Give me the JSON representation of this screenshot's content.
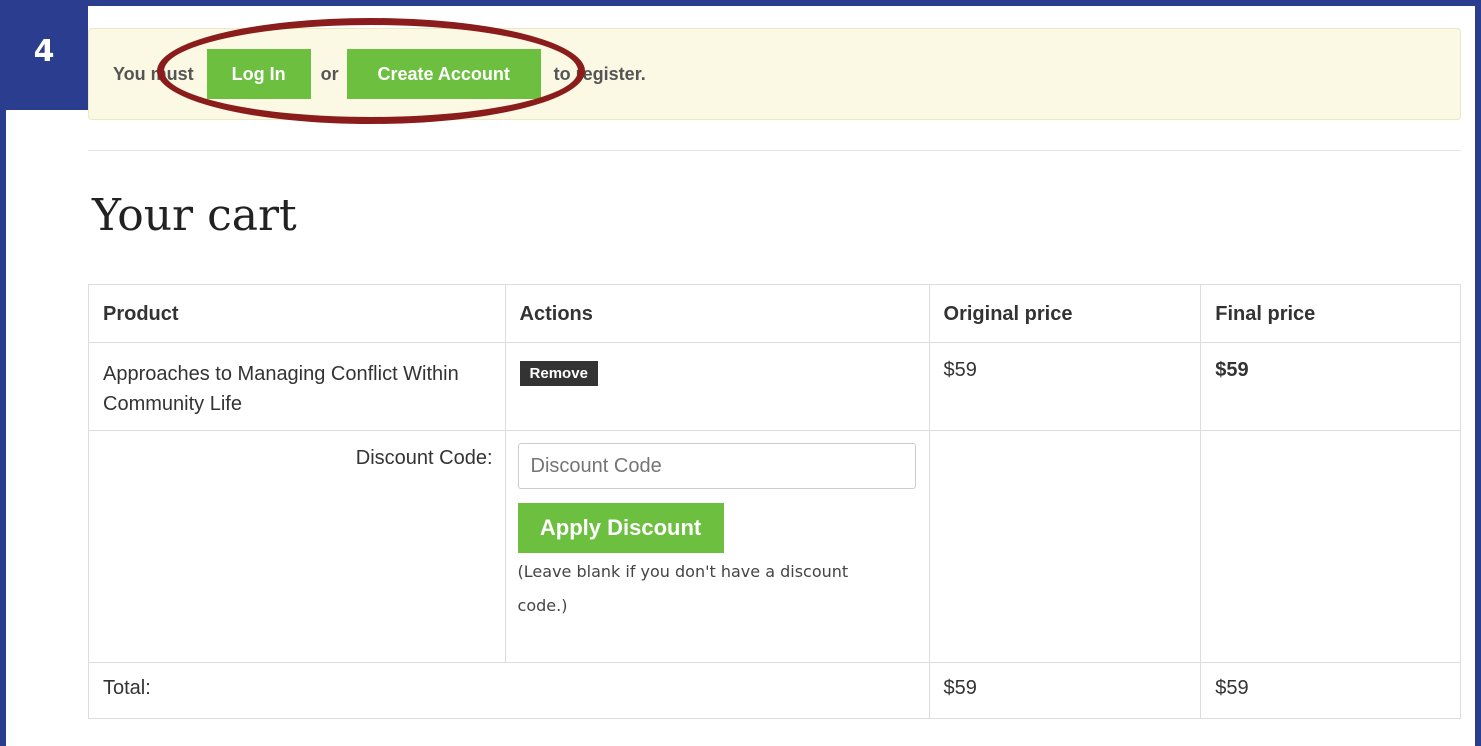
{
  "step": {
    "number": "4"
  },
  "alert": {
    "prefix": "You must ",
    "login_label": "Log In",
    "middle": "or",
    "create_label": "Create Account",
    "suffix": " to register."
  },
  "page": {
    "title": "Your cart"
  },
  "table": {
    "headers": [
      "Product",
      "Actions",
      "Original price",
      "Final price"
    ],
    "item": {
      "product": "Approaches to Managing Conflict Within Community Life",
      "action_label": "Remove",
      "original_price": "$59",
      "final_price": "$59"
    },
    "discount": {
      "label": "Discount Code:",
      "placeholder": "Discount Code",
      "value": "",
      "apply_label": "Apply Discount",
      "help": "(Leave blank if you don't have a discount code.)"
    },
    "total": {
      "label": "Total:",
      "original": "$59",
      "final": "$59"
    }
  },
  "colors": {
    "frame": "#2b3d8f",
    "accent_green": "#6cbf3f",
    "highlight": "#8a1c1c",
    "alert_bg": "#fbf8e3"
  }
}
